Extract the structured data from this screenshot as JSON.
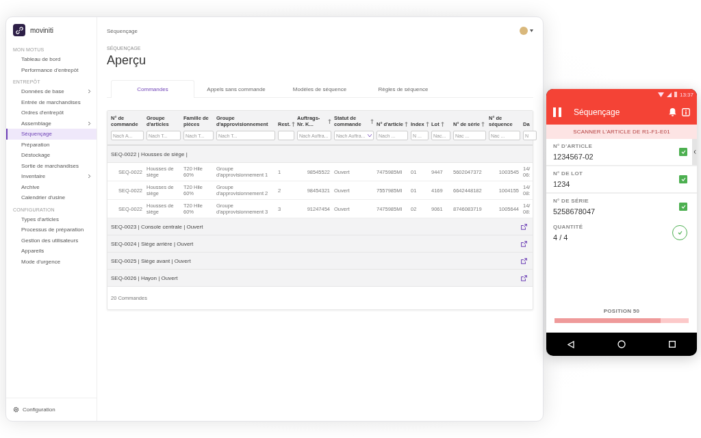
{
  "desktop": {
    "logo": "moviniti",
    "breadcrumb": "Séquençage",
    "overline": "SÉQUENÇAGE",
    "title": "Aperçu",
    "sidebar": [
      {
        "heading": "MON MOTUS",
        "items": [
          {
            "label": "Tableau de bord",
            "selected": false,
            "expandable": false
          },
          {
            "label": "Performance d'entrepôt",
            "selected": false,
            "expandable": false
          }
        ]
      },
      {
        "heading": "ENTREPÔT",
        "items": [
          {
            "label": "Données de base",
            "selected": false,
            "expandable": true
          },
          {
            "label": "Entrée de marchandises",
            "selected": false,
            "expandable": false
          },
          {
            "label": "Ordres d'entrepôt",
            "selected": false,
            "expandable": false
          },
          {
            "label": "Assemblage",
            "selected": false,
            "expandable": true
          },
          {
            "label": "Séquençage",
            "selected": true,
            "expandable": false
          },
          {
            "label": "Préparation",
            "selected": false,
            "expandable": false
          },
          {
            "label": "Déstockage",
            "selected": false,
            "expandable": false
          },
          {
            "label": "Sortie de marchandises",
            "selected": false,
            "expandable": false
          },
          {
            "label": "Inventaire",
            "selected": false,
            "expandable": true
          },
          {
            "label": "Archive",
            "selected": false,
            "expandable": false
          },
          {
            "label": "Calendrier d'usine",
            "selected": false,
            "expandable": false
          }
        ]
      },
      {
        "heading": "CONFIGURATION",
        "items": [
          {
            "label": "Types d'articles",
            "selected": false,
            "expandable": false
          },
          {
            "label": "Processus de préparation",
            "selected": false,
            "expandable": false
          },
          {
            "label": "Gestion des utilisateurs",
            "selected": false,
            "expandable": false
          },
          {
            "label": "Appareils",
            "selected": false,
            "expandable": false
          },
          {
            "label": "Mode d'urgence",
            "selected": false,
            "expandable": false
          }
        ]
      }
    ],
    "sidebar_footer": "Configuration",
    "tabs": [
      {
        "label": "Commandes",
        "selected": true
      },
      {
        "label": "Appels sans commande",
        "selected": false
      },
      {
        "label": "Modèles de séquence",
        "selected": false
      },
      {
        "label": "Règles de séquence",
        "selected": false
      }
    ],
    "table": {
      "columns": [
        {
          "label": "N° de commande",
          "sortable": false,
          "filter": "Nach A...",
          "kind": "text"
        },
        {
          "label": "Groupe d'articles",
          "sortable": false,
          "filter": "Nach T...",
          "kind": "text"
        },
        {
          "label": "Famille de pièces",
          "sortable": false,
          "filter": "Nach T...",
          "kind": "text"
        },
        {
          "label": "Groupe d'approvisionnement",
          "sortable": false,
          "filter": "Nach T...",
          "kind": "text"
        },
        {
          "label": "Rest.",
          "sortable": true,
          "kind": "text"
        },
        {
          "label": "Auftrags-Nr. K...",
          "sortable": true,
          "filter": "Nach Auftra...",
          "kind": "text"
        },
        {
          "label": "Statut de commande",
          "sortable": true,
          "filter": "Nach Auftra...",
          "kind": "select"
        },
        {
          "label": "N° d'article",
          "sortable": true,
          "filter": "Nach ...",
          "kind": "text"
        },
        {
          "label": "Index",
          "sortable": true,
          "filter": "N ...",
          "kind": "text"
        },
        {
          "label": "Lot",
          "sortable": true,
          "filter": "Nac...",
          "kind": "text"
        },
        {
          "label": "N° de série",
          "sortable": true,
          "filter": "Nac ...",
          "kind": "text"
        },
        {
          "label": "N° de séquence",
          "sortable": false,
          "filter": "Nac ...",
          "kind": "text"
        },
        {
          "label": "Da",
          "sortable": false,
          "filter": "N",
          "kind": "text"
        }
      ],
      "groups": [
        {
          "label": "SEQ-0022 | Housses de siège |",
          "expanded": true,
          "rows": [
            [
              "SEQ-0022",
              "Housses de siège",
              "T20 Hile 60%",
              "Groupe d'approvisionnement 1",
              "1",
              "98545522",
              "Ouvert",
              "7475985MI",
              "01",
              "9447",
              "5602047372",
              "1003545",
              "14/ 06:"
            ],
            [
              "SEQ-0022",
              "Housses de siège",
              "T20 Hile 60%",
              "Groupe d'approvisionnement 2",
              "2",
              "98454321",
              "Ouvert",
              "7557985MI",
              "01",
              "4169",
              "6642448182",
              "1004155",
              "14/ 08:"
            ],
            [
              "SEQ-0022",
              "Housses de siège",
              "T20 Hile 60%",
              "Groupe d'approvisionnement 3",
              "3",
              "91247454",
              "Ouvert",
              "7475985MI",
              "02",
              "9061",
              "8746083719",
              "1005644",
              "14/ 08:"
            ]
          ]
        },
        {
          "label": "SEQ-0023 | Console centrale | Ouvert",
          "expanded": false
        },
        {
          "label": "SEQ-0024 | Siège arrière | Ouvert",
          "expanded": false
        },
        {
          "label": "SEQ-0025 | Siège avant | Ouvert",
          "expanded": false
        },
        {
          "label": "SEQ-0026 | Hayon | Ouvert",
          "expanded": false
        }
      ],
      "footer": "20 Commandes"
    }
  },
  "phone": {
    "time": "13:37",
    "title": "Séquençage",
    "banner": "SCANNER L'ARTICLE DE R1-F1-E01",
    "fields": [
      {
        "kind": "checkbox",
        "label": "N° D'ARTICLE",
        "value": "1234567-02",
        "checked": true
      },
      {
        "kind": "checkbox",
        "label": "N° DE LOT",
        "value": "1234",
        "checked": true
      },
      {
        "kind": "checkbox",
        "label": "N° DE SÉRIE",
        "value": "5258678047",
        "checked": true
      },
      {
        "kind": "circle",
        "label": "QUANTITÉ",
        "value": "4 / 4",
        "checked": true
      }
    ],
    "position": "POSITION 50",
    "level": 0.79
  }
}
